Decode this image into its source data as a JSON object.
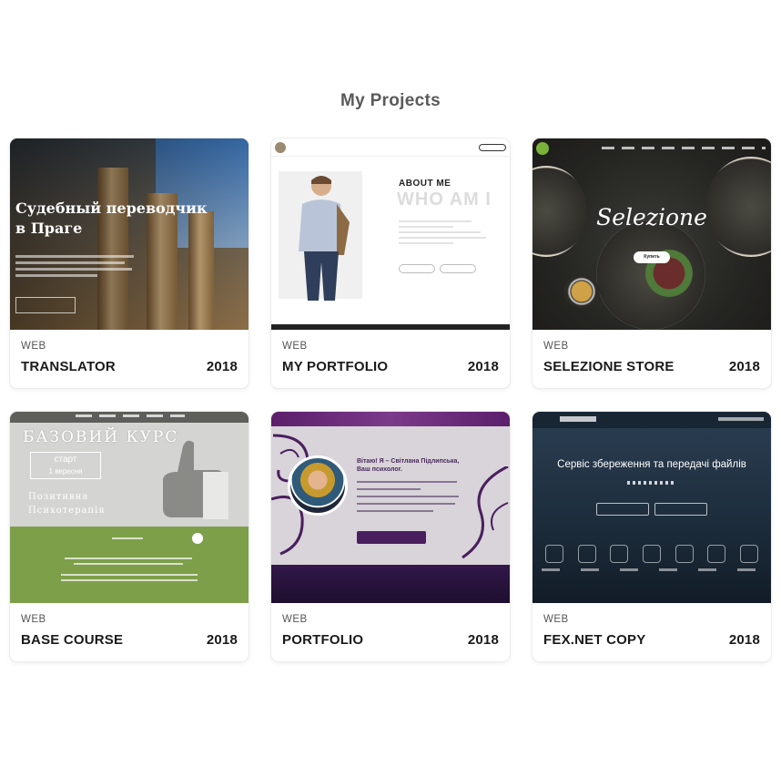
{
  "section": {
    "title": "My Projects"
  },
  "projects": [
    {
      "category": "WEB",
      "name": "TRANSLATOR",
      "year": "2018",
      "preview": {
        "heading_1": "Судебный переводчик",
        "heading_2": "в Праге"
      }
    },
    {
      "category": "WEB",
      "name": "MY PORTFOLIO",
      "year": "2018",
      "preview": {
        "about": "ABOUT ME",
        "who": "WHO AM I"
      }
    },
    {
      "category": "WEB",
      "name": "SELEZIONE STORE",
      "year": "2018",
      "preview": {
        "title": "Selezione",
        "button": "Купить"
      }
    },
    {
      "category": "WEB",
      "name": "BASE COURSE",
      "year": "2018",
      "preview": {
        "heading": "БАЗОВИЙ КУРС",
        "box_1": "старт",
        "box_2": "1 вересня",
        "sub_1": "Позитивна",
        "sub_2": "Психотерапія"
      }
    },
    {
      "category": "WEB",
      "name": "PORTFOLIO",
      "year": "2018",
      "preview": {
        "heading_1": "Вітаю! Я – Світлана Підлипська,",
        "heading_2": "Ваш психолог."
      }
    },
    {
      "category": "WEB",
      "name": "FEX.NET COPY",
      "year": "2018",
      "preview": {
        "heading": "Сервіс збереження та передачі файлів"
      }
    }
  ]
}
